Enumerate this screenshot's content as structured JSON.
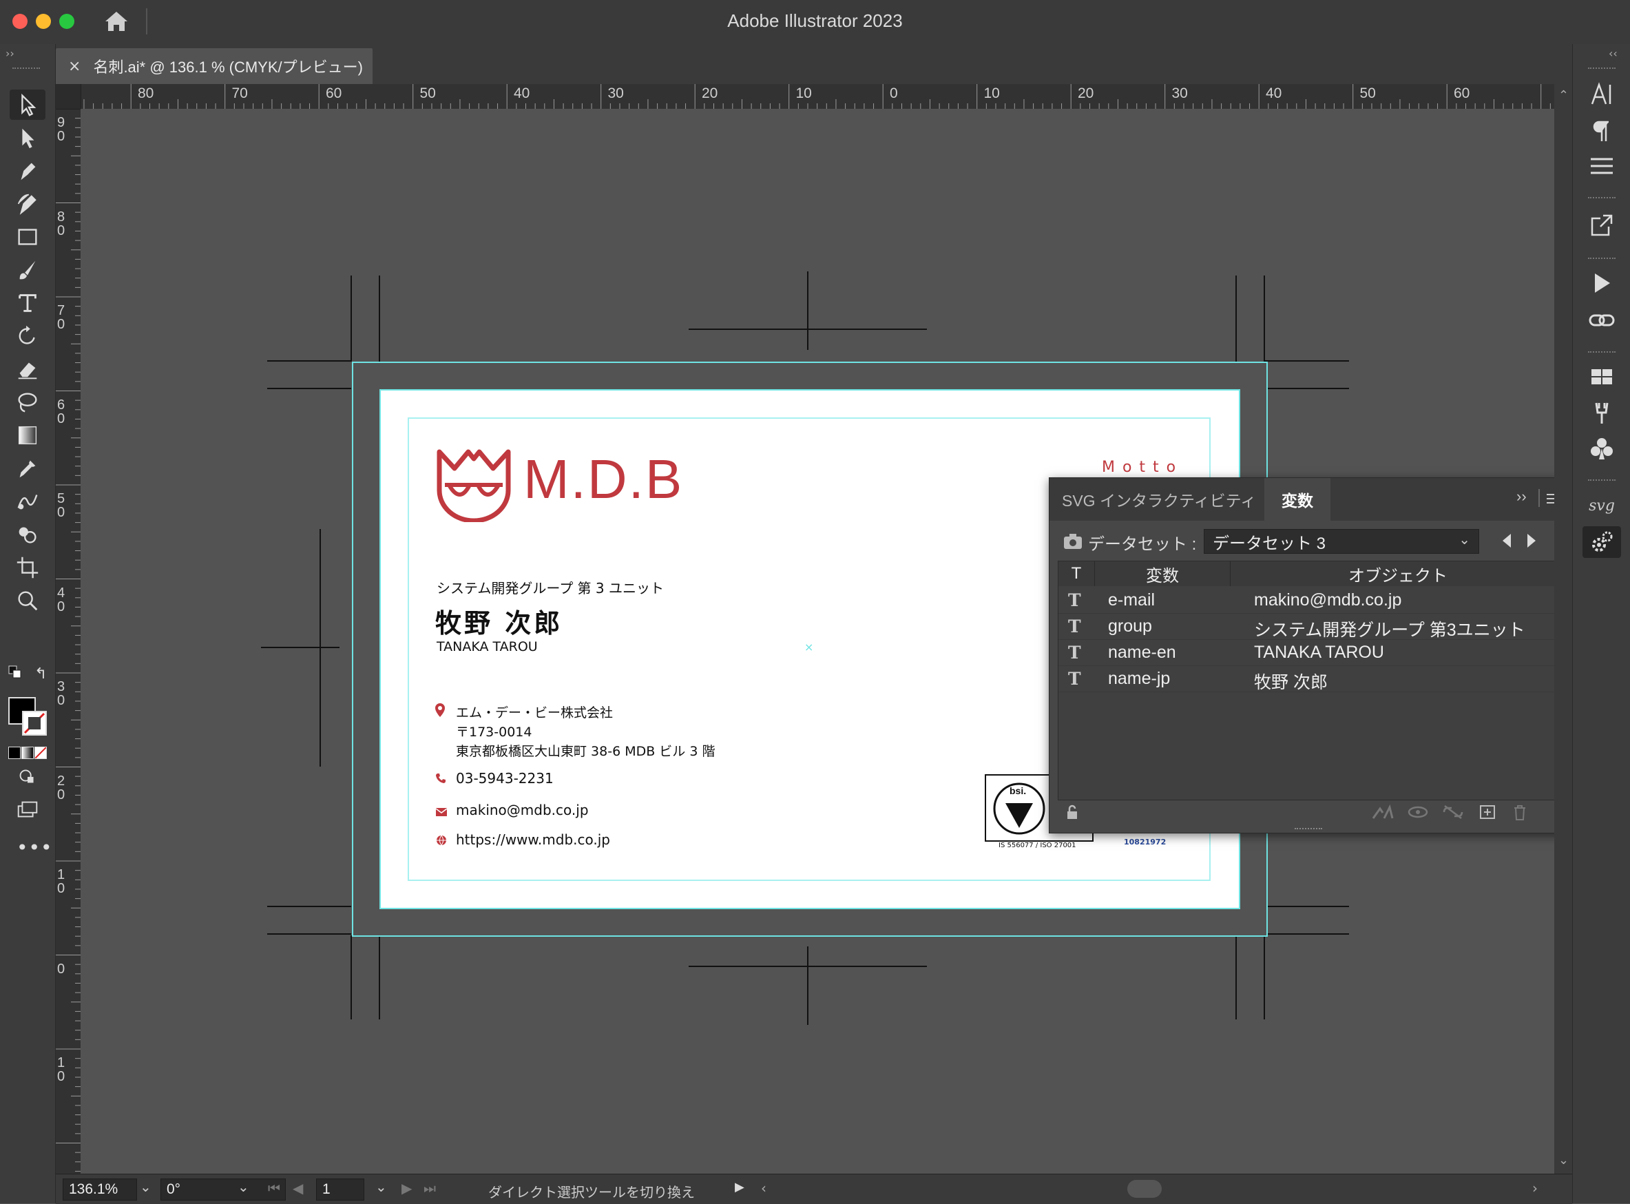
{
  "app": {
    "title": "Adobe Illustrator 2023"
  },
  "document_tab": {
    "close": "×",
    "label": "名刺.ai* @ 136.1 % (CMYK/プレビュー)"
  },
  "rulers": {
    "horizontal": [
      "80",
      "70",
      "60",
      "50",
      "40",
      "30",
      "20",
      "10",
      "0",
      "10",
      "20",
      "30",
      "40",
      "50",
      "60"
    ],
    "vertical": [
      "9\n0",
      "8\n0",
      "7\n0",
      "6\n0",
      "5\n0",
      "4\n0",
      "3\n0",
      "2\n0",
      "1\n0",
      "0",
      "1\n0"
    ]
  },
  "card": {
    "logo_text": "M.D.B",
    "motto": "M o t t o",
    "group": "システム開発グループ 第 3 ユニット",
    "name_jp": "牧野 次郎",
    "name_en": "TANAKA TAROU",
    "company": "エム・デー・ビー株式会社",
    "postal": "〒173-0014",
    "address": "東京都板橋区大山東町 38-6 MDB ビル 3 階",
    "phone": "03-5943-2231",
    "email": "makino@mdb.co.jp",
    "url": "https://www.mdb.co.jp",
    "cert_label": "IS 556077 / ISO 27001",
    "cert_logo": "bsi.",
    "cert_number": "10821972"
  },
  "variables_panel": {
    "tabs": [
      "SVG インタラクティビティ",
      "変数"
    ],
    "active_tab": "変数",
    "dataset_label": "データセット :",
    "dataset_value": "データセット 3",
    "columns": [
      "T",
      "変数",
      "オブジェクト"
    ],
    "rows": [
      {
        "type": "T",
        "variable": "e-mail",
        "object": "makino@mdb.co.jp"
      },
      {
        "type": "T",
        "variable": "group",
        "object": "システム開発グループ 第3ユニット"
      },
      {
        "type": "T",
        "variable": "name-en",
        "object": "TANAKA TAROU"
      },
      {
        "type": "T",
        "variable": "name-jp",
        "object": "牧野 次郎"
      }
    ]
  },
  "status_bar": {
    "zoom": "136.1%",
    "rotation": "0°",
    "artboard": "1",
    "hint": "ダイレクト選択ツールを切り換え"
  },
  "colors": {
    "accent_red": "#c0393e",
    "guide_cyan": "#6fe3e3",
    "panel_bg": "#474747"
  }
}
